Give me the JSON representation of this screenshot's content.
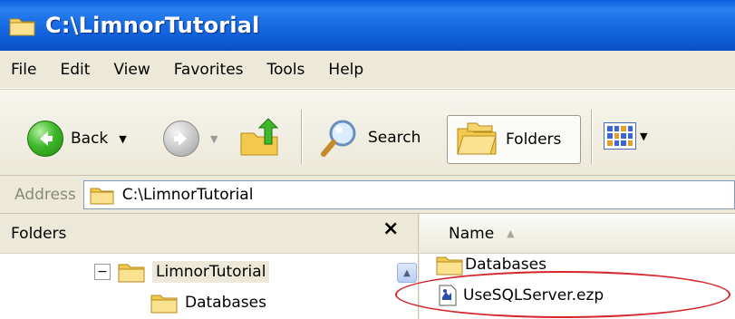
{
  "window": {
    "title": "C:\\LimnorTutorial"
  },
  "menu": {
    "items": [
      "File",
      "Edit",
      "View",
      "Favorites",
      "Tools",
      "Help"
    ]
  },
  "toolbar": {
    "back_label": "Back",
    "search_label": "Search",
    "folders_label": "Folders",
    "icons": [
      "back-arrow-icon",
      "forward-arrow-icon",
      "folder-up-icon",
      "search-magnifier-icon",
      "folders-icon",
      "views-icon"
    ]
  },
  "address": {
    "label": "Address",
    "value": "C:\\LimnorTutorial"
  },
  "folders_pane": {
    "header": "Folders",
    "close_symbol": "×",
    "tree": [
      {
        "label": "LimnorTutorial",
        "expander": "−",
        "selected": true
      },
      {
        "label": "Databases"
      }
    ]
  },
  "files_pane": {
    "column_header": "Name",
    "files": [
      {
        "name": "Databases",
        "type": "folder"
      },
      {
        "name": "UseSQLServer.ezp",
        "type": "ezp-file",
        "highlighted": true
      }
    ]
  },
  "colors": {
    "titlebar": "#0e5bd4",
    "highlight_ellipse": "#d4262c",
    "folder_yellow": "#f2c94c"
  }
}
